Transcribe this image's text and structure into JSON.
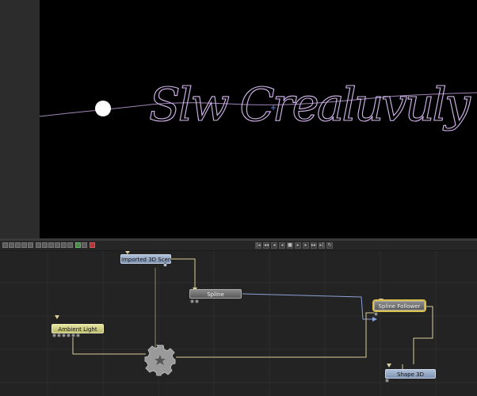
{
  "viewer": {
    "script_text": "Slw Crealuvuly"
  },
  "graph": {
    "nodes": {
      "imported_scene": "Imported 3D Scen...",
      "spline": "Spline",
      "spline_follower": "Spline Follower",
      "ambient_light": "Ambient Light",
      "shape_3d": "Shape 3D"
    }
  },
  "colors": {
    "viewer_bg": "#000000",
    "stroke": "#c9a6e6",
    "graph_bg": "#232323",
    "wire": "#d8cf9a",
    "wire_blue": "#8aa2d6",
    "selected": "#d8c04a"
  },
  "icons": [
    "gear-icon",
    "play-icon",
    "stop-icon",
    "rewind-icon",
    "forward-icon"
  ]
}
